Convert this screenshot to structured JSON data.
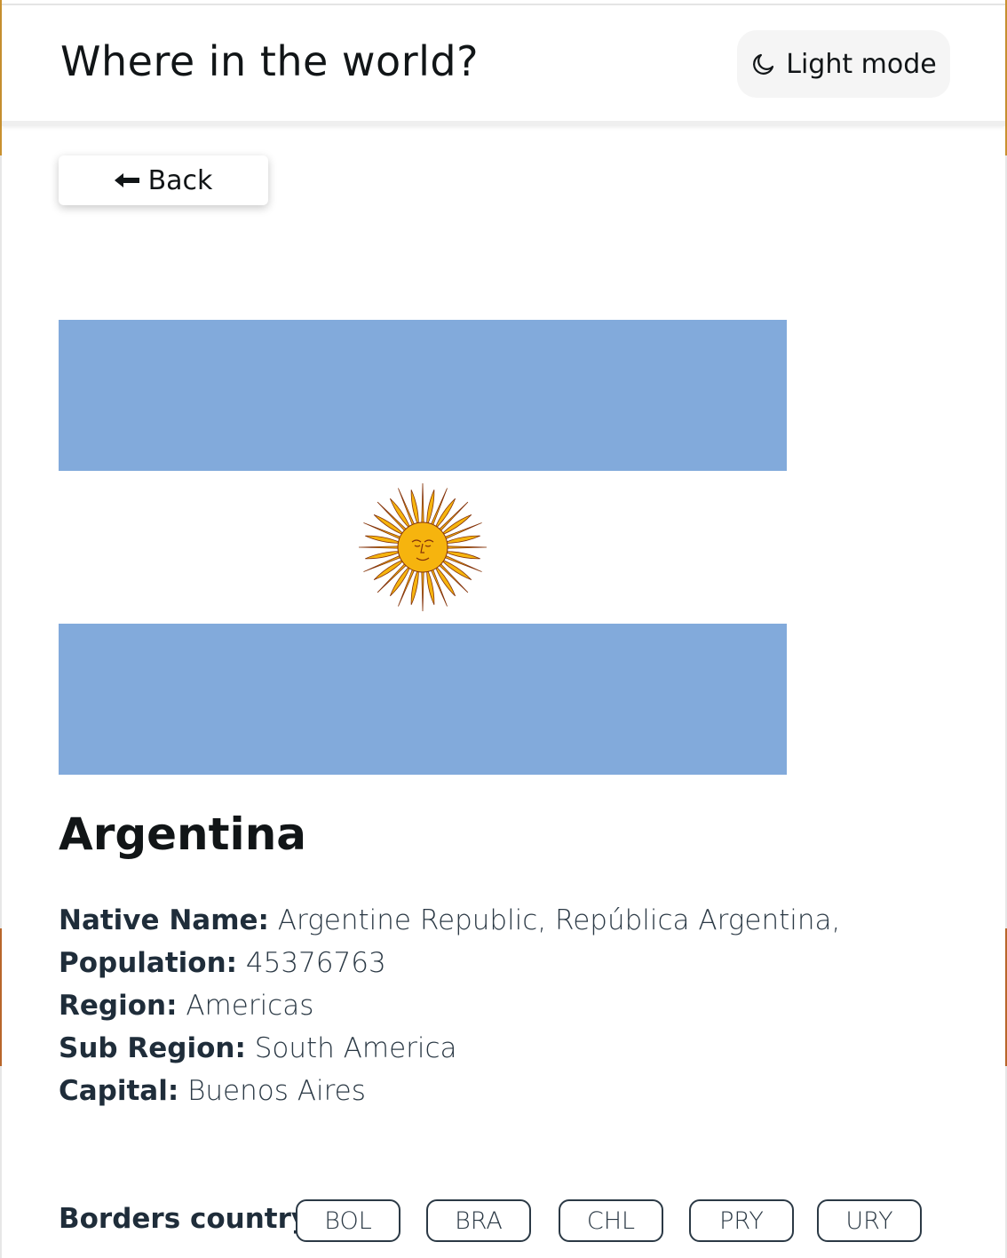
{
  "header": {
    "title": "Where in the world?",
    "mode_label": "Light mode",
    "mode_icon": "moon-icon"
  },
  "back_button": {
    "label": "Back",
    "icon": "arrow-left-icon"
  },
  "flag": {
    "country": "Argentina",
    "colors": {
      "stripe": "#82aadb",
      "middle": "#ffffff",
      "sun": "#f6b40e",
      "sun_outline": "#85340a"
    }
  },
  "country": {
    "name": "Argentina",
    "details": [
      {
        "label": "Native Name:",
        "value": "Argentine Republic, República Argentina,"
      },
      {
        "label": "Population:",
        "value": "45376763"
      },
      {
        "label": "Region:",
        "value": "Americas"
      },
      {
        "label": "Sub Region:",
        "value": "South America"
      },
      {
        "label": "Capital:",
        "value": "Buenos Aires"
      }
    ],
    "borders_label": "Borders country:",
    "borders": [
      "BOL",
      "BRA",
      "CHL",
      "PRY",
      "URY"
    ]
  },
  "colors": {
    "text_dark": "#111517",
    "text_body": "#2b3945",
    "header_bg": "#ffffff",
    "toggle_bg": "#f5f5f5"
  }
}
